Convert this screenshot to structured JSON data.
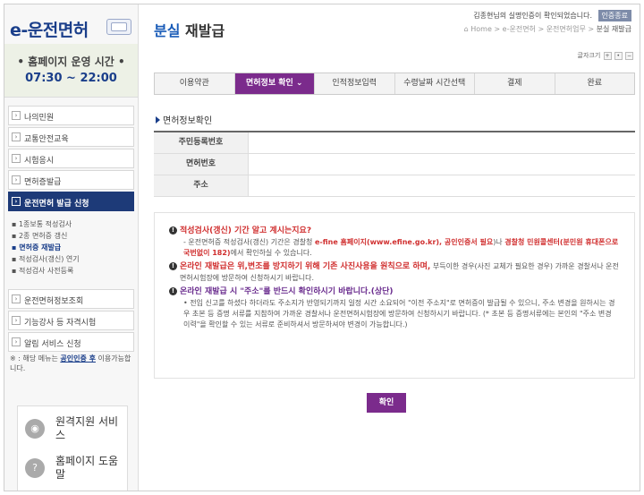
{
  "sidebar": {
    "logo": "e-운전면허",
    "hours_title": "• 홈페이지 운영 시간 •",
    "hours_time": "07:30 ~ 22:00",
    "menu_top": [
      {
        "label": "나의민원"
      },
      {
        "label": "교통안전교육"
      },
      {
        "label": "시험응시"
      },
      {
        "label": "면허증발급"
      },
      {
        "label": "운전면허 발급 신청"
      }
    ],
    "submenu": [
      {
        "label": "1종보통 적성검사"
      },
      {
        "label": "2종 면허증 갱신"
      },
      {
        "label": "면허증 재발급"
      },
      {
        "label": "적성검사(갱신) 연기"
      },
      {
        "label": "적성검사 사전등록"
      }
    ],
    "menu_bottom": [
      {
        "label": "운전면허정보조회"
      },
      {
        "label": "기능강사 등 자격시험"
      },
      {
        "label": "알림 서비스 신청"
      }
    ],
    "side_note_prefix": "※ : 해당 메뉴는",
    "side_note_link": "공인인증 후",
    "side_note_suffix": "이용가능합니다.",
    "help": [
      {
        "label": "원격지원 서비스"
      },
      {
        "label": "홈페이지 도움말"
      }
    ]
  },
  "header": {
    "title_blue": "분실",
    "title_rest": " 재발급",
    "login_msg": "김종현님의 실명인증이 확인되었습니다.",
    "logout_label": "인증종료",
    "breadcrumb": "⌂ Home > e-운전면허 > 운전면허업무 > ",
    "breadcrumb_last": "분실 재발급",
    "fontsize_label": "글자크기"
  },
  "steps": [
    {
      "label": "이용약관"
    },
    {
      "label": "면허정보 확인 ⌄"
    },
    {
      "label": "인적정보입력"
    },
    {
      "label": "수령날짜 시간선택"
    },
    {
      "label": "결제"
    },
    {
      "label": "완료"
    }
  ],
  "section": {
    "title": "면허정보확인",
    "rows": [
      {
        "label": "주민등록번호",
        "value": ""
      },
      {
        "label": "면허번호",
        "value": ""
      },
      {
        "label": "주소",
        "value": ""
      }
    ]
  },
  "notice": {
    "item1_head": "적성검사(갱신) 기간 알고 계시는지요?",
    "item1_body_a": "- 운전면허증 적성검사(갱신) 기간은 경찰청 ",
    "item1_body_link": "e-fine 홈페이지(www.efine.go.kr), 공인인증서 필요",
    "item1_body_b": ")나 ",
    "item1_body_red": "경찰청 민원콜센터(분민원 휴대폰으로 국번없이 182)",
    "item1_body_c": "에서 확인하실 수 있습니다.",
    "item2_head": "온라인 재발급은 위,변조를 방지하기 위해 기존 사진사용을 원칙으로 하며,",
    "item2_body": "부득이한 경우(사진 교체가 필요한 경우) 가까운 경찰서나 운전면허시험장에 방문하여 신청하시기 바랍니다.",
    "item3_head": "온라인 재발급 시 \"주소\"를 반드시 확인하시기 바랍니다.(상단)",
    "item3_body": "• 전입 신고를 하셨다 하더라도 주소지가 반영되기까지 일정 시간 소요되어 \"이전 주소지\"로 면허증이 발급될 수 있으니, 주소 변경을 원하시는 경우 초본 등 증명 서류를 지참하여 가까운 경찰서나 운전면허시험장에 방문하여 신청하시기 바랍니다. (* 초본 등 증명서류에는 본인의 \"주소 변경 이력\"을 확인할 수 있는 서류로 준비하셔서 방문하셔야 변경이 가능합니다.)"
  },
  "confirm_label": "확인"
}
